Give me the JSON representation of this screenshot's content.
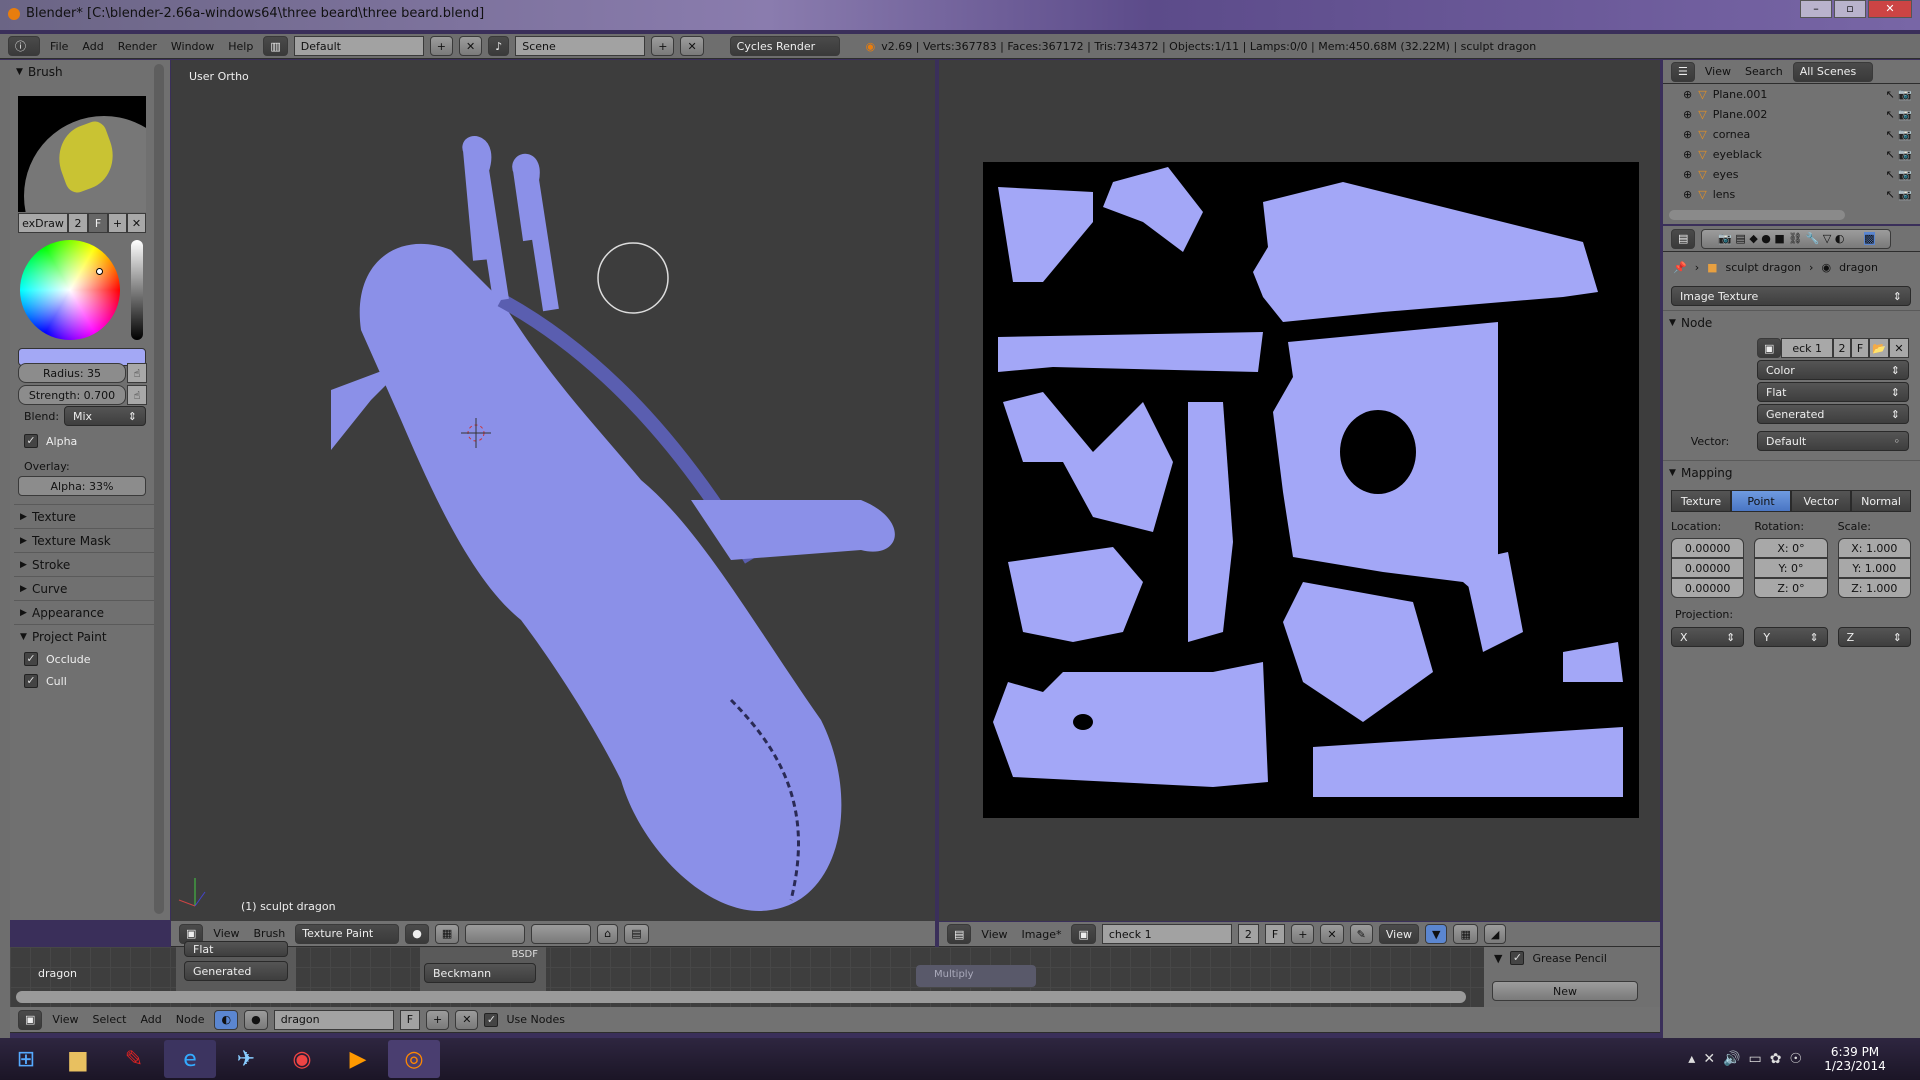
{
  "window": {
    "title": "Blender* [C:\\blender-2.66a-windows64\\three beard\\three beard.blend]",
    "buttons": [
      "–",
      "▫",
      "✕"
    ]
  },
  "info_header": {
    "menus": [
      "File",
      "Add",
      "Render",
      "Window",
      "Help"
    ],
    "layout": "Default",
    "scene": "Scene",
    "engine": "Cycles Render",
    "stats": "v2.69 | Verts:367783 | Faces:367172 | Tris:734372 | Objects:1/11 | Lamps:0/0 | Mem:450.68M (32.22M) | sculpt dragon"
  },
  "tool_panel": {
    "brush_header": "Brush",
    "brush_name": "exDraw",
    "brush_users": "2",
    "fake_user": "F",
    "radius": "Radius: 35",
    "strength": "Strength: 0.700",
    "blend_label": "Blend:",
    "blend_value": "Mix",
    "alpha_label": "Alpha",
    "overlay_label": "Overlay:",
    "overlay_alpha": "Alpha: 33%",
    "color": "#a3a8f5",
    "sections": [
      "Texture",
      "Texture Mask",
      "Stroke",
      "Curve",
      "Appearance"
    ],
    "project_paint": "Project Paint",
    "occlude": "Occlude",
    "cull": "Cull"
  },
  "viewport": {
    "view_label": "User Ortho",
    "object_label": "(1) sculpt dragon",
    "mesh_color": "#8b90e8",
    "header": {
      "menus": [
        "View",
        "Brush"
      ],
      "mode": "Texture Paint"
    }
  },
  "image_editor": {
    "header": {
      "menus": [
        "View",
        "Image*"
      ],
      "image_name": "check 1",
      "users": "2",
      "fake": "F",
      "view": "View"
    },
    "island_color": "#a3a7f7"
  },
  "node_editor": {
    "material_label": "dragon",
    "dropdown_flat": "Flat",
    "dropdown_generated": "Generated",
    "bsdf_label": "BSDF",
    "beckmann": "Beckmann",
    "multiply": "Multiply",
    "header": {
      "menus": [
        "View",
        "Select",
        "Add",
        "Node"
      ],
      "material": "dragon",
      "fake": "F",
      "use_nodes": "Use Nodes"
    },
    "grease_pencil": {
      "title": "Grease Pencil",
      "new_label": "New"
    }
  },
  "outliner": {
    "menus": [
      "View",
      "Search"
    ],
    "scope": "All Scenes",
    "items": [
      "Plane.001",
      "Plane.002",
      "cornea",
      "eyeblack",
      "eyes",
      "lens"
    ]
  },
  "properties": {
    "breadcrumb": [
      "sculpt dragon",
      "dragon"
    ],
    "texture_node": "Image Texture",
    "node_section": "Node",
    "image": "eck 1",
    "image_users": "2",
    "image_fake": "F",
    "color_space": "Color",
    "projection_mode": "Flat",
    "source": "Generated",
    "vector_label": "Vector:",
    "vector_value": "Default",
    "mapping_section": "Mapping",
    "mapping_tabs": [
      "Texture",
      "Point",
      "Vector",
      "Normal"
    ],
    "active_tab": "Point",
    "location_label": "Location:",
    "rotation_label": "Rotation:",
    "scale_label": "Scale:",
    "location": [
      "0.00000",
      "0.00000",
      "0.00000"
    ],
    "rotation": [
      "X: 0°",
      "Y: 0°",
      "Z: 0°"
    ],
    "scale": [
      "X: 1.000",
      "Y: 1.000",
      "Z: 1.000"
    ],
    "projection_label": "Projection:",
    "projection": [
      "X",
      "Y",
      "Z"
    ]
  },
  "taskbar": {
    "time": "6:39 PM",
    "date": "1/23/2014"
  }
}
